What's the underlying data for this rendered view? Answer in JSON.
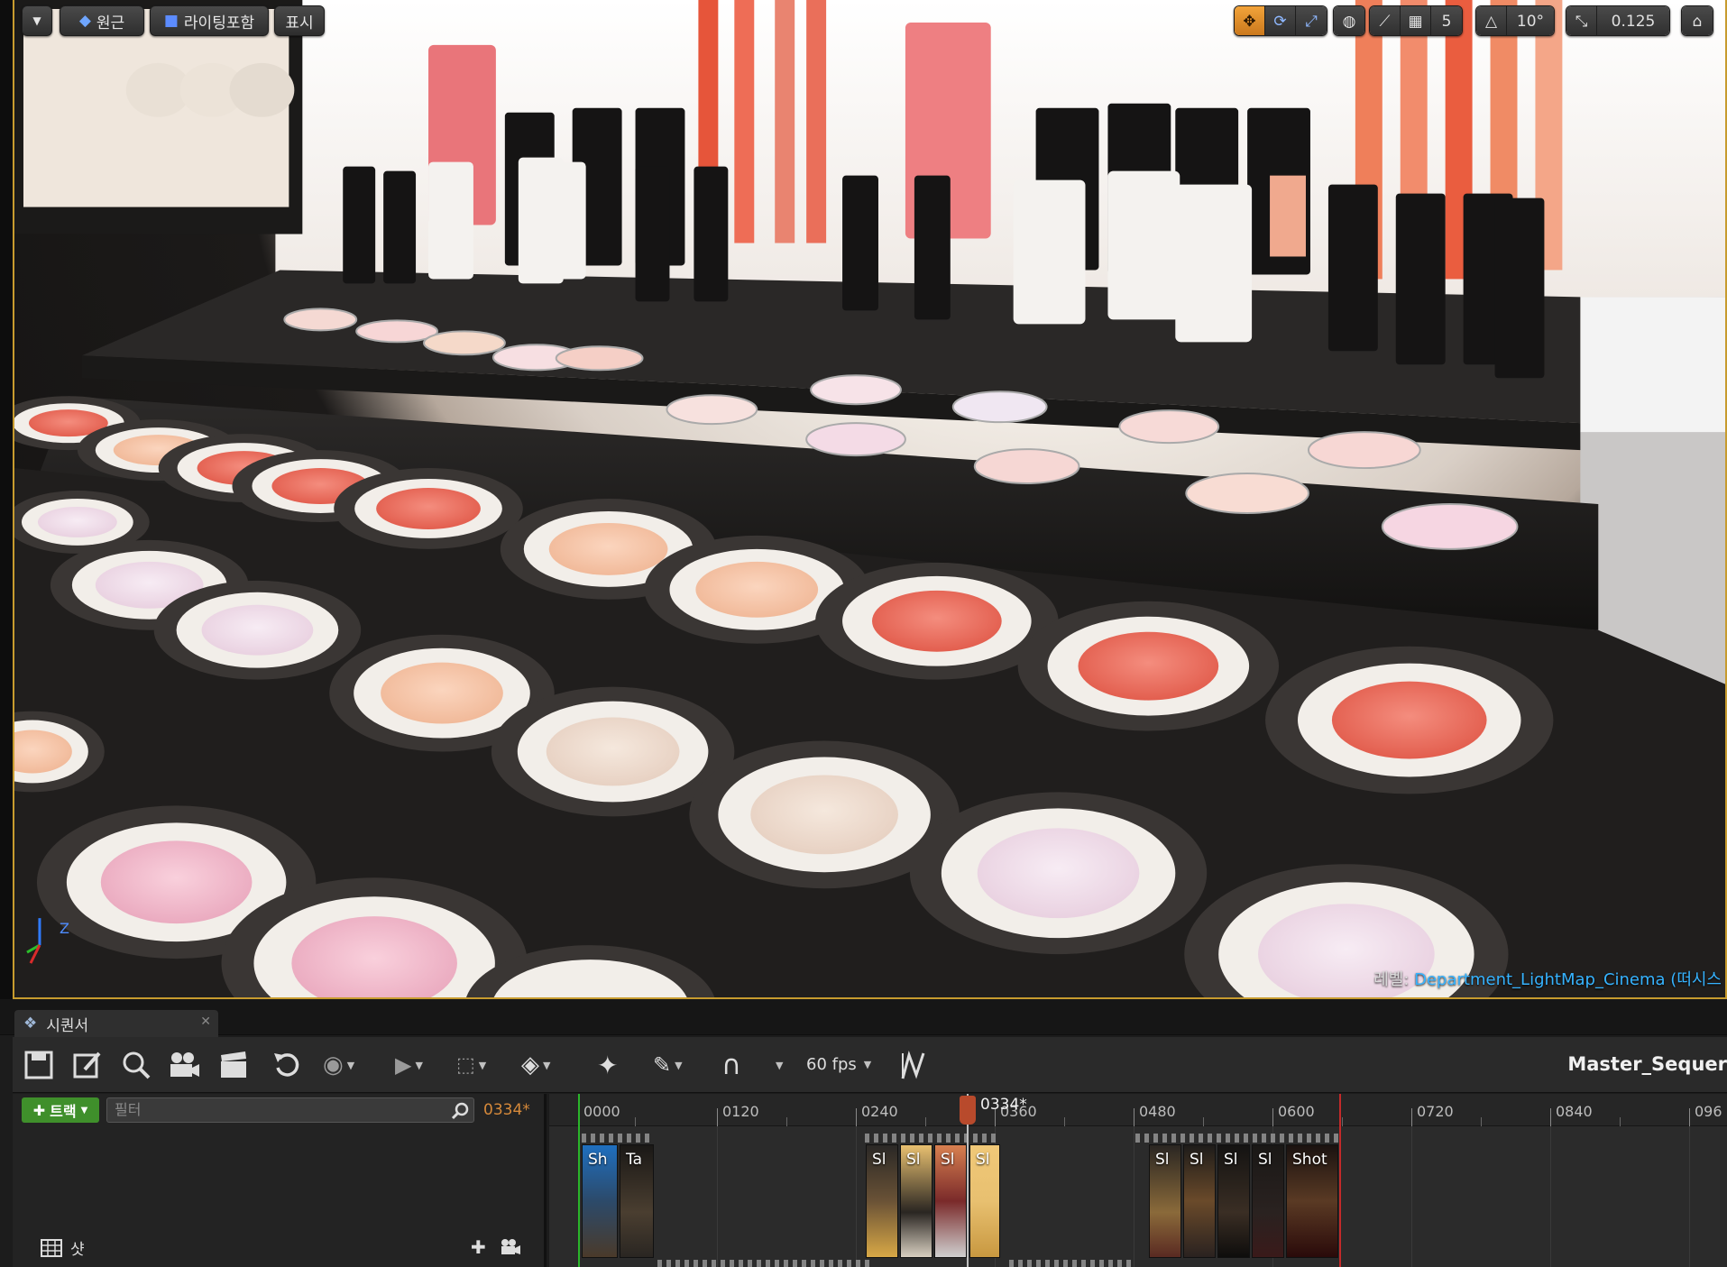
{
  "viewport": {
    "toolbar": {
      "perspective_label": "원근",
      "lit_label": "라이팅포함",
      "show_label": "표시",
      "grid_snap_value": "5",
      "rotation_snap_value": "10°",
      "scale_snap_value": "0.125"
    },
    "level": {
      "prefix": "레벨:",
      "name": "Department_LightMap_Cinema (떠시스"
    },
    "axis": {
      "z": "Z"
    }
  },
  "sequencer": {
    "tab_label": "시퀀서",
    "fps_label": "60 fps",
    "sequence_name": "Master_Sequer",
    "add_track_label": "트랙",
    "filter_placeholder": "필터",
    "current_frame": "0334*",
    "playhead_label": "0334*",
    "shot_track_label": "샷",
    "ruler": [
      "0000",
      "0120",
      "0240",
      "0360",
      "0480",
      "0600",
      "0720",
      "0840",
      "096"
    ],
    "shots": [
      {
        "label": "Sh"
      },
      {
        "label": "Ta"
      },
      {
        "label": "Sl"
      },
      {
        "label": "Sl"
      },
      {
        "label": "Sl"
      },
      {
        "label": "Sl"
      },
      {
        "label": "Sl"
      },
      {
        "label": "Sl"
      },
      {
        "label": "Sl"
      },
      {
        "label": "Sl"
      },
      {
        "label": "Shot"
      }
    ]
  },
  "colors": {
    "accent_orange": "#e38b2a",
    "playhead": "#b84a2c",
    "add_track_green": "#3f8f2b",
    "level_link": "#36b3ff"
  }
}
